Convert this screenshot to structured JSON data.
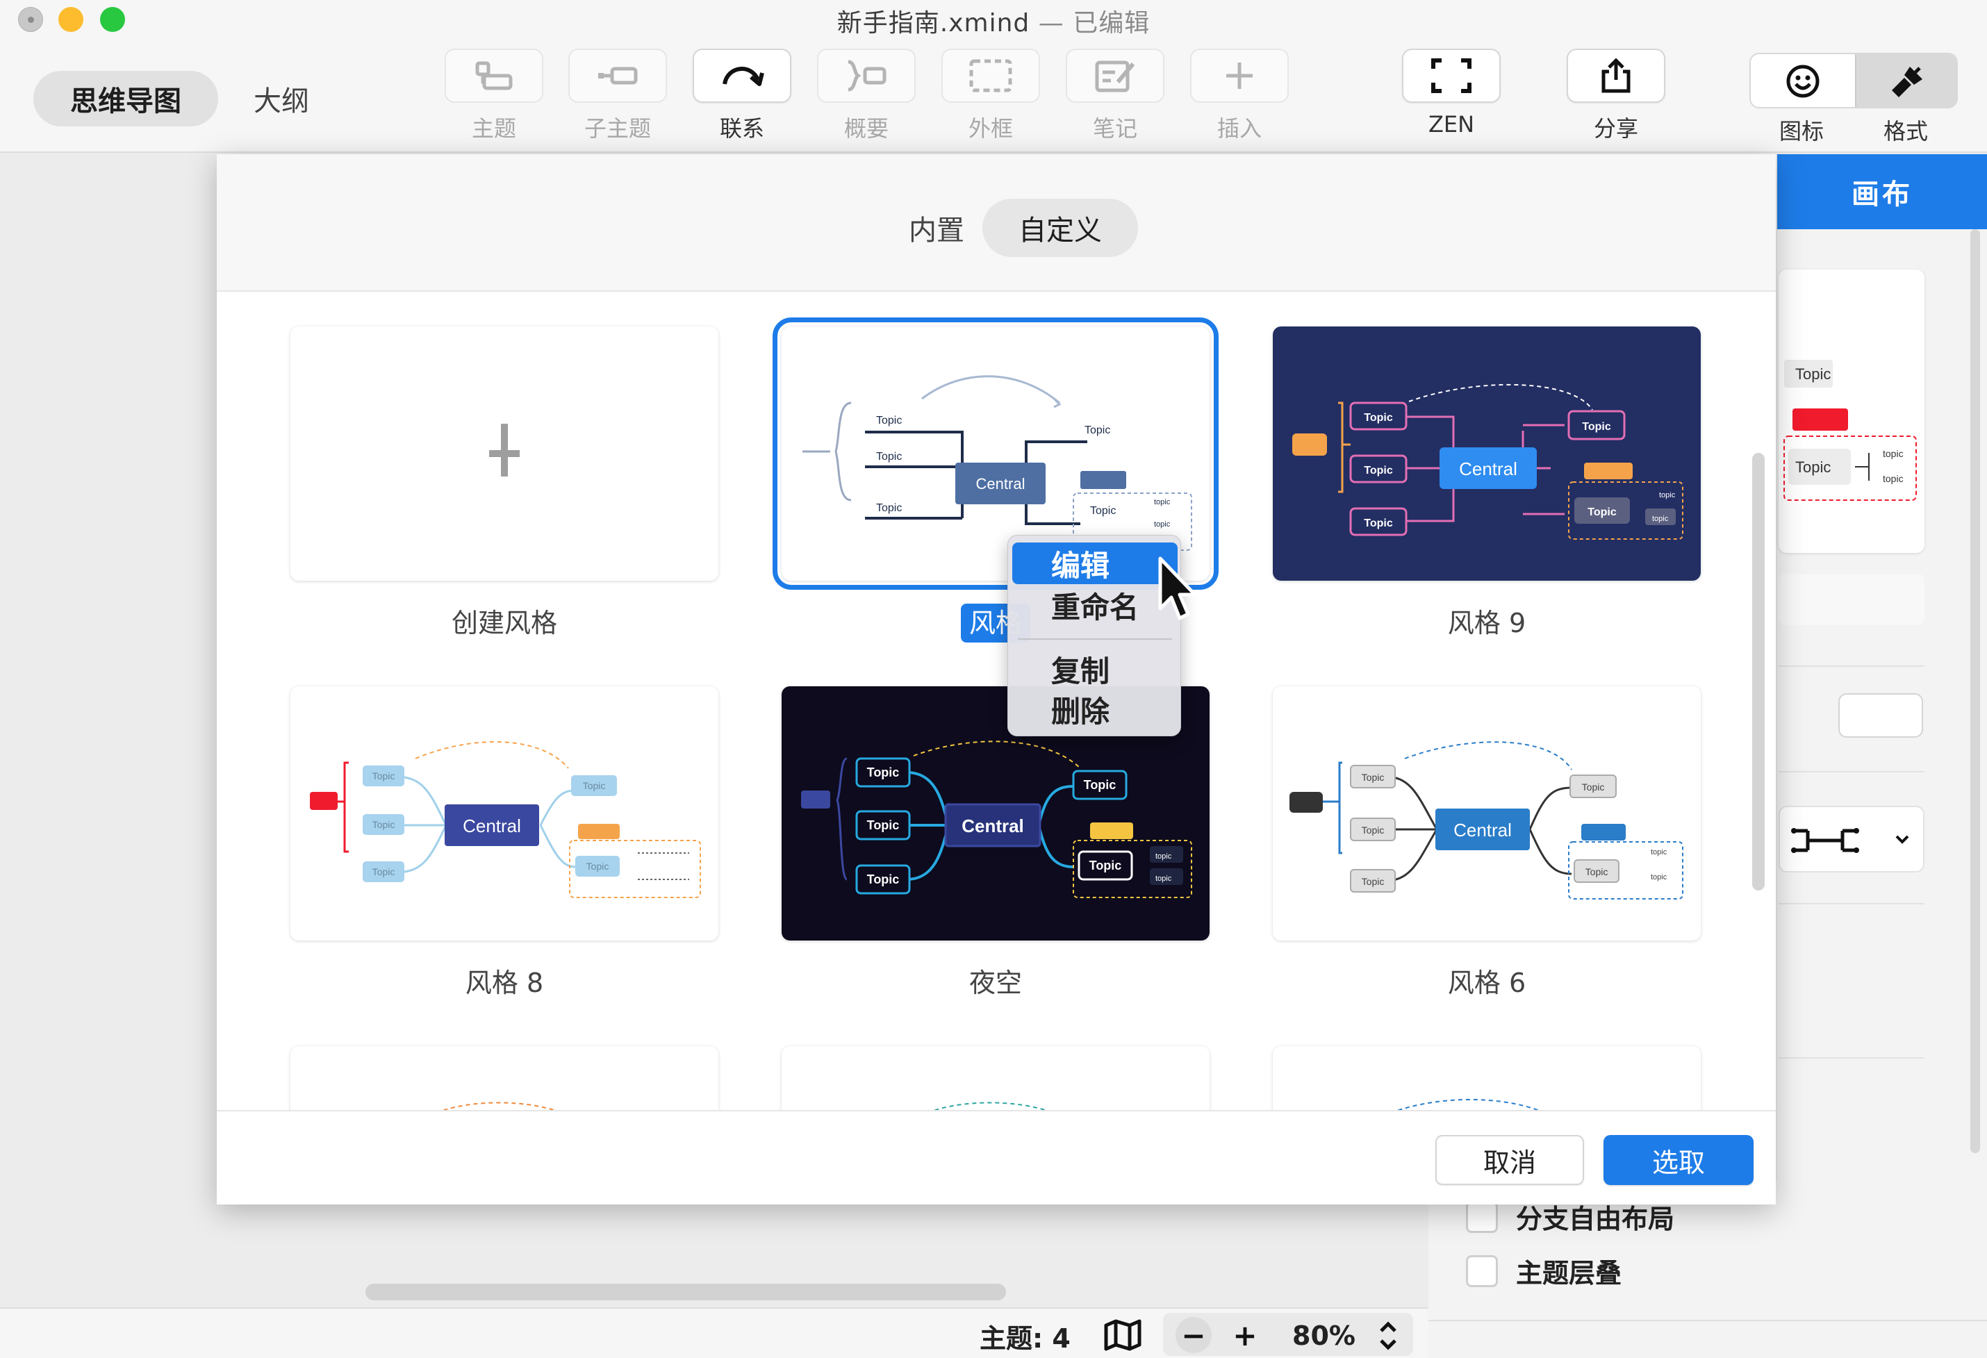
{
  "window": {
    "title": "新手指南.xmind",
    "edited": "— 已编辑"
  },
  "toolbar": {
    "mode_tabs": [
      "思维导图",
      "大纲"
    ],
    "buttons": [
      {
        "label": "主题",
        "icon": "topic-icon",
        "enabled": false
      },
      {
        "label": "子主题",
        "icon": "subtopic-icon",
        "enabled": false
      },
      {
        "label": "联系",
        "icon": "relationship-icon",
        "enabled": true
      },
      {
        "label": "概要",
        "icon": "summary-icon",
        "enabled": false
      },
      {
        "label": "外框",
        "icon": "boundary-icon",
        "enabled": false
      },
      {
        "label": "笔记",
        "icon": "note-icon",
        "enabled": false
      },
      {
        "label": "插入",
        "icon": "insert-plus-icon",
        "enabled": false
      },
      {
        "label": "ZEN",
        "icon": "zen-fullscreen-icon",
        "enabled": true
      },
      {
        "label": "分享",
        "icon": "share-icon",
        "enabled": true
      }
    ],
    "right_tabs": [
      "图标",
      "格式"
    ]
  },
  "format_panel": {
    "tab": "画布",
    "preview_labels": [
      "Topic",
      "Topic",
      "topic",
      "topic"
    ],
    "checkboxes": [
      {
        "label": "分支自由布局",
        "checked": false
      },
      {
        "label": "主题层叠",
        "checked": false
      }
    ]
  },
  "dialog": {
    "tabs": [
      "内置",
      "自定义"
    ],
    "active_tab": "自定义",
    "cards": [
      {
        "label": "创建风格",
        "kind": "create"
      },
      {
        "label": "风格",
        "kind": "light-blue",
        "selected": true
      },
      {
        "label": "风格 9",
        "kind": "navy"
      },
      {
        "label": "风格 8",
        "kind": "light-pastel"
      },
      {
        "label": "夜空",
        "kind": "night"
      },
      {
        "label": "风格 6",
        "kind": "light-gray"
      }
    ],
    "topic_text": "Topic",
    "central_text": "Central",
    "small_topic": "topic",
    "cancel": "取消",
    "confirm": "选取"
  },
  "context_menu": {
    "items": [
      "编辑",
      "重命名",
      "复制",
      "删除"
    ],
    "highlighted": "编辑"
  },
  "status": {
    "topics": "主题: 4",
    "zoom": "80%",
    "zoom_minus": "−",
    "zoom_plus": "+"
  },
  "colors": {
    "accent": "#1e7ce8",
    "navy": "#232e63",
    "night": "#0d0b1d"
  }
}
